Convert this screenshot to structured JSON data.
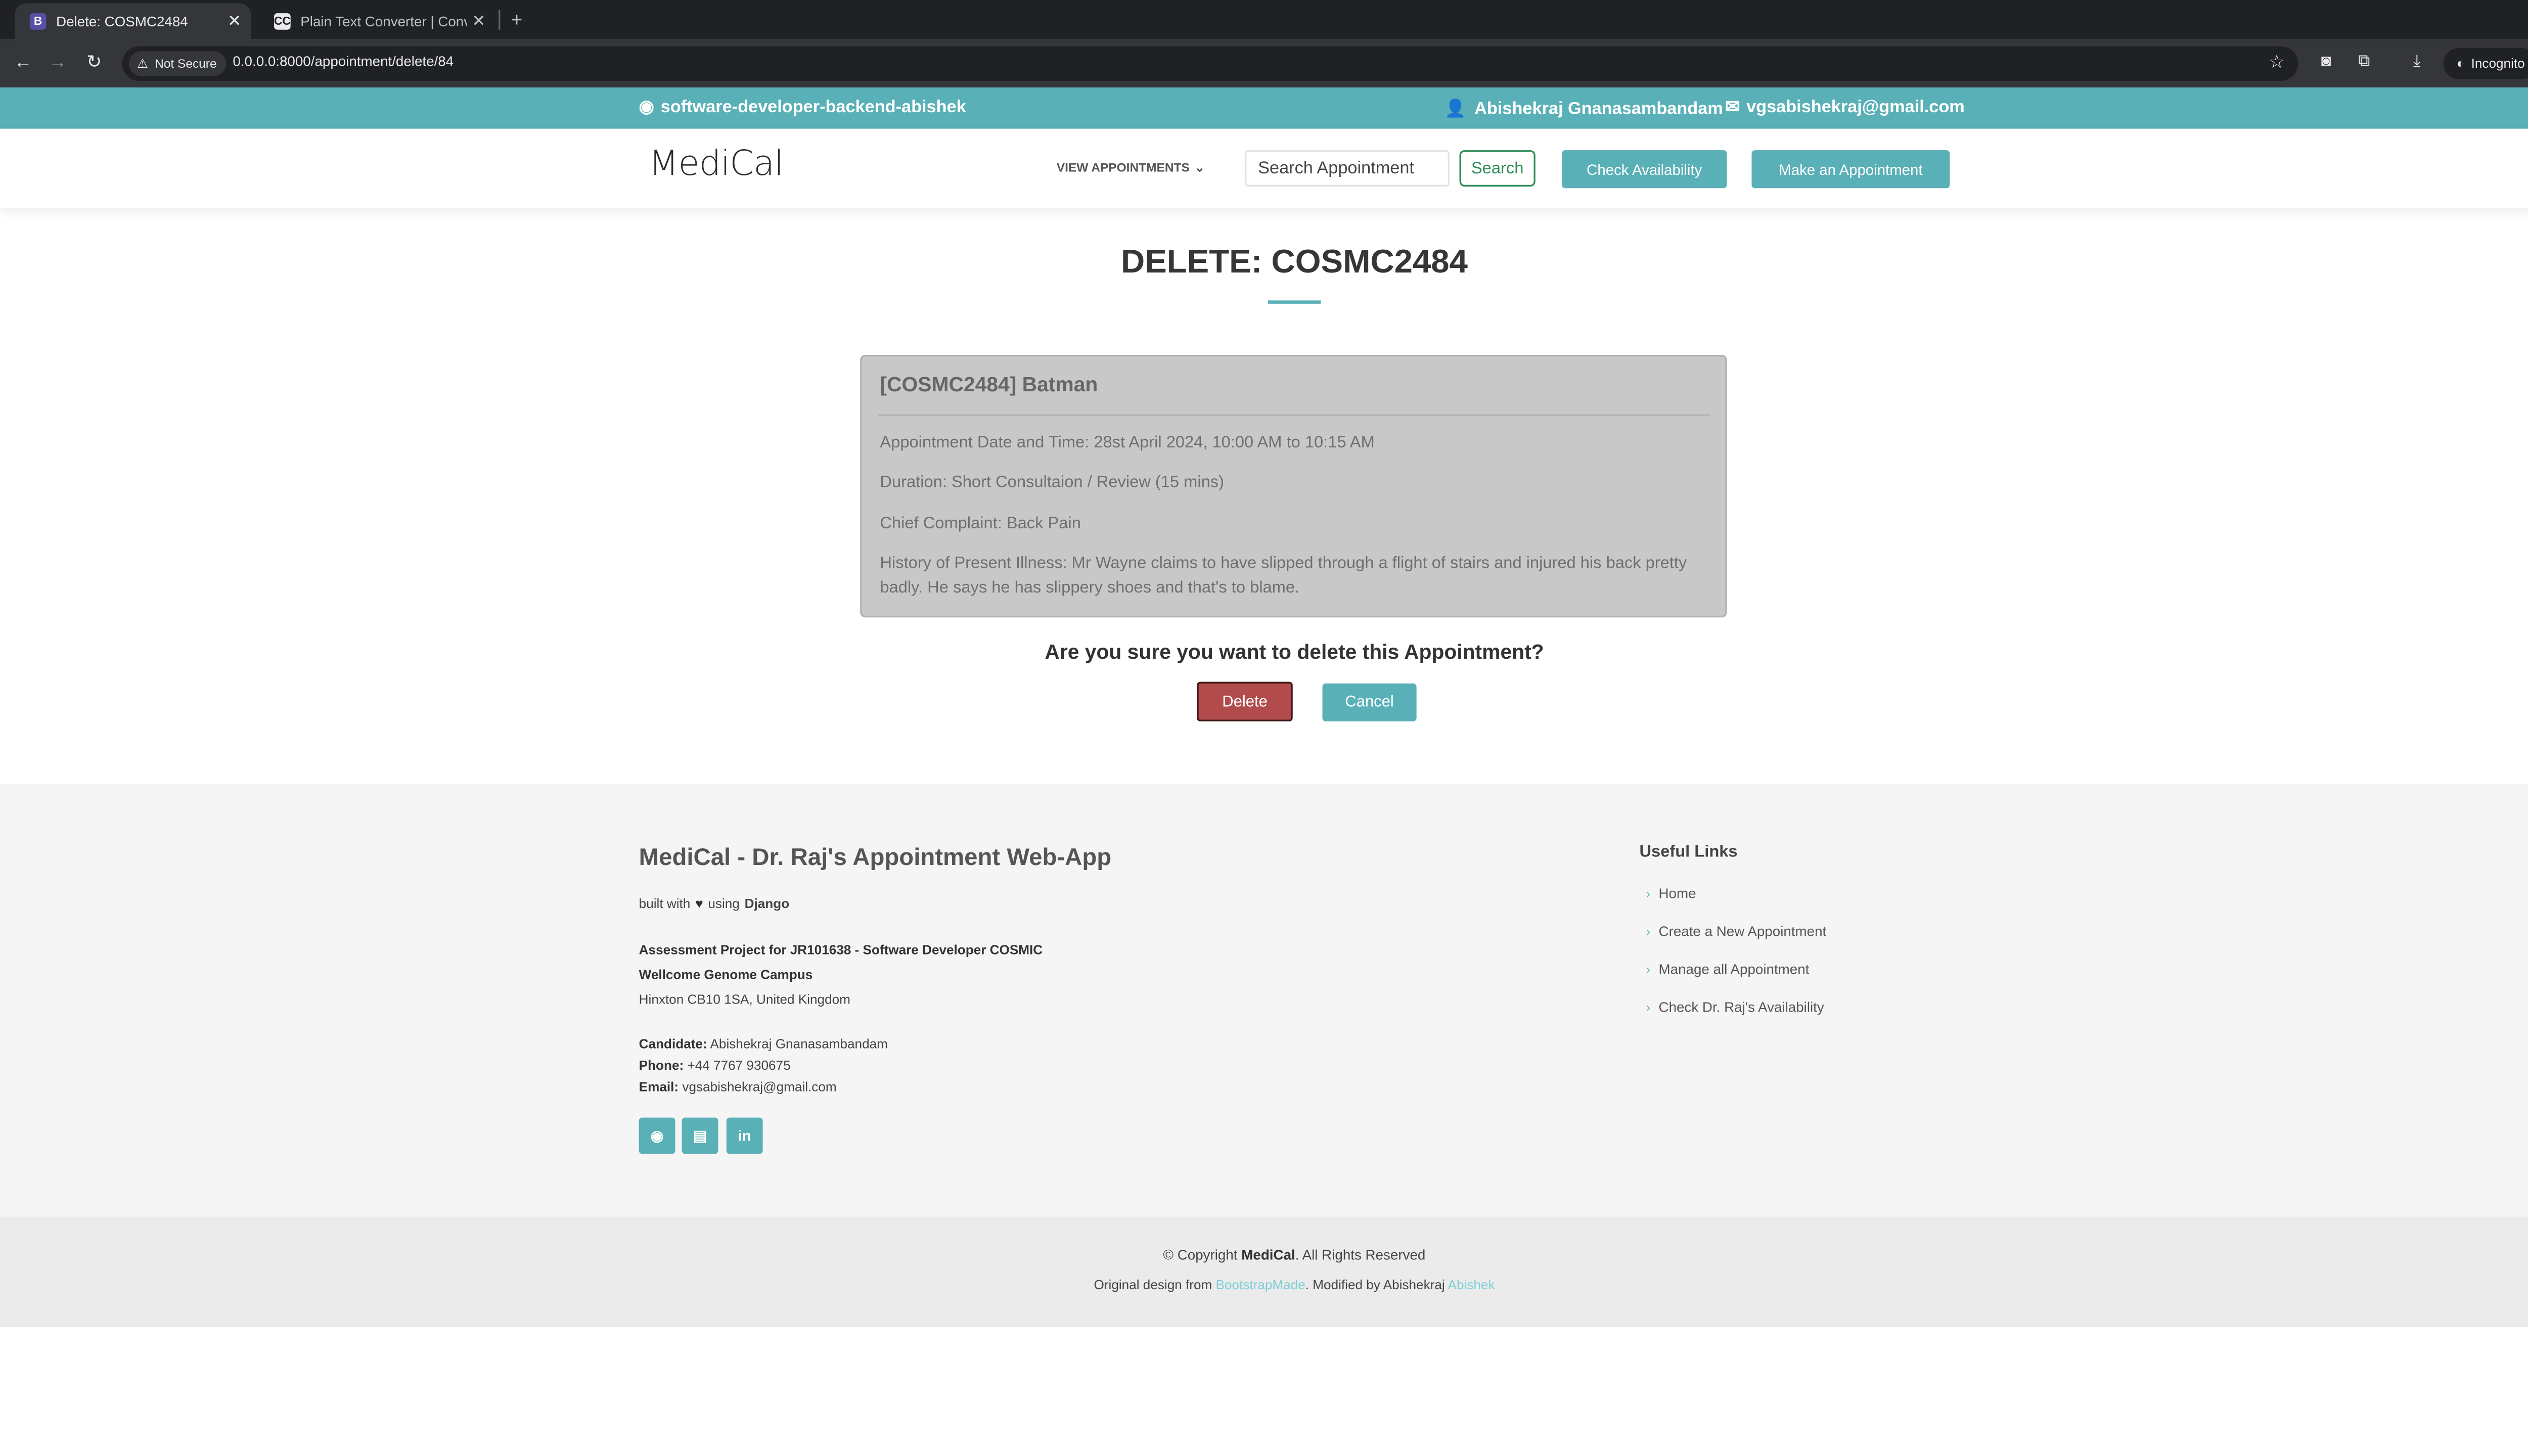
{
  "browser": {
    "tabs": [
      {
        "favicon": "B",
        "title": "Delete: COSMC2484",
        "active": true
      },
      {
        "favicon": "CC",
        "title": "Plain Text Converter | Conve",
        "active": false
      }
    ],
    "security_label": "Not Secure",
    "url": "0.0.0.0:8000/appointment/delete/84",
    "profile_label": "Incognito"
  },
  "topbar": {
    "github": "software-developer-backend-abishek",
    "user": "Abishekraj Gnanasambandam",
    "email": "vgsabishekraj@gmail.com"
  },
  "header": {
    "logo": "MediCal",
    "nav_dropdown": "VIEW APPOINTMENTS",
    "search_placeholder": "Search Appointment",
    "search_button": "Search",
    "check_button": "Check Availability",
    "make_button": "Make an Appointment"
  },
  "main": {
    "title": "DELETE: COSMC2484",
    "card": {
      "title": "[COSMC2484] Batman",
      "datetime": "Appointment Date and Time: 28st April 2024, 10:00 AM to 10:15 AM",
      "duration": "Duration: Short Consultaion / Review (15 mins)",
      "complaint": "Chief Complaint: Back Pain",
      "history": "History of Present Illness: Mr Wayne claims to have slipped through a flight of stairs and injured his back pretty badly. He says he has slippery shoes and that's to blame."
    },
    "confirm_text": "Are you sure you want to delete this Appointment?",
    "delete_button": "Delete",
    "cancel_button": "Cancel"
  },
  "footer": {
    "title": "MediCal - Dr. Raj's Appointment Web-App",
    "built_prefix": "built with",
    "built_using": "using",
    "built_framework": "Django",
    "project": "Assessment Project for JR101638 - Software Developer COSMIC",
    "campus": "Wellcome Genome Campus",
    "address": "Hinxton CB10 1SA, United Kingdom",
    "candidate_label": "Candidate:",
    "candidate": "Abishekraj Gnanasambandam",
    "phone_label": "Phone:",
    "phone": "+44 7767 930675",
    "email_label": "Email:",
    "email": "vgsabishekraj@gmail.com",
    "useful_links_title": "Useful Links",
    "useful_links": [
      "Home",
      "Create a New Appointment",
      "Manage all Appointment",
      "Check Dr. Raj's Availability"
    ],
    "copyright_prefix": "© Copyright",
    "copyright_brand": "MediCal",
    "copyright_suffix": ". All Rights Reserved",
    "credits_prefix": "Original design from",
    "credits_link1": "BootstrapMade",
    "credits_middle": ". Modified by Abishekraj",
    "credits_link2": "Abishek"
  }
}
